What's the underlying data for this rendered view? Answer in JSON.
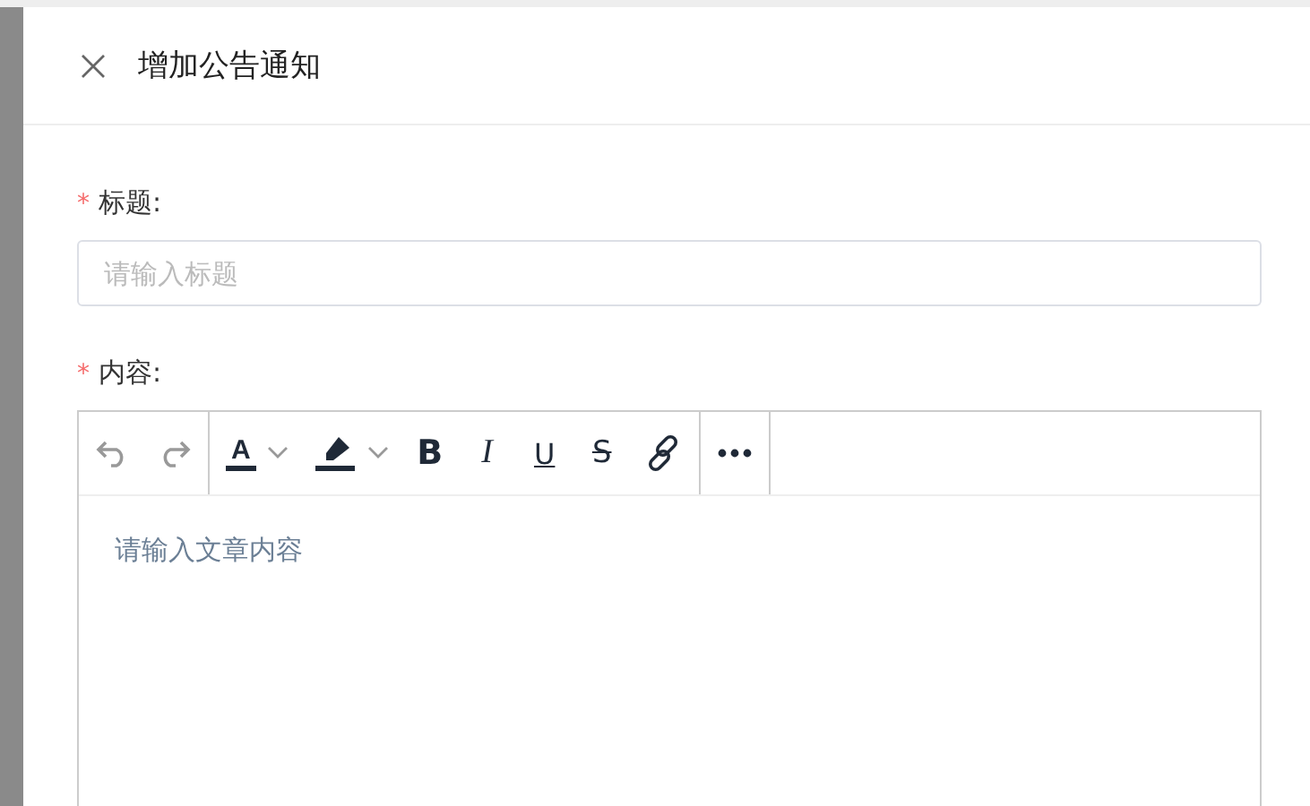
{
  "drawer": {
    "title": "增加公告通知"
  },
  "fields": [
    {
      "label": "标题:",
      "required_mark": "*",
      "kind": "input",
      "placeholder": "请输入标题"
    },
    {
      "label": "内容:",
      "required_mark": "*",
      "kind": "editor",
      "placeholder": "请输入文章内容",
      "toolbar": [
        {
          "items": [
            {
              "kind": "undo",
              "disabled": true
            },
            {
              "kind": "redo",
              "disabled": true
            }
          ]
        },
        {
          "items": [
            {
              "kind": "font-color",
              "glyph": "A",
              "disabled": false
            },
            {
              "kind": "highlight",
              "disabled": false
            },
            {
              "kind": "bold",
              "glyph": "B",
              "disabled": false
            },
            {
              "kind": "italic",
              "glyph": "I",
              "disabled": false
            },
            {
              "kind": "underline",
              "glyph": "U",
              "disabled": false
            },
            {
              "kind": "strike",
              "glyph": "S",
              "disabled": false
            },
            {
              "kind": "link",
              "disabled": false
            }
          ]
        },
        {
          "items": [
            {
              "kind": "more",
              "disabled": false
            }
          ]
        }
      ]
    }
  ]
}
